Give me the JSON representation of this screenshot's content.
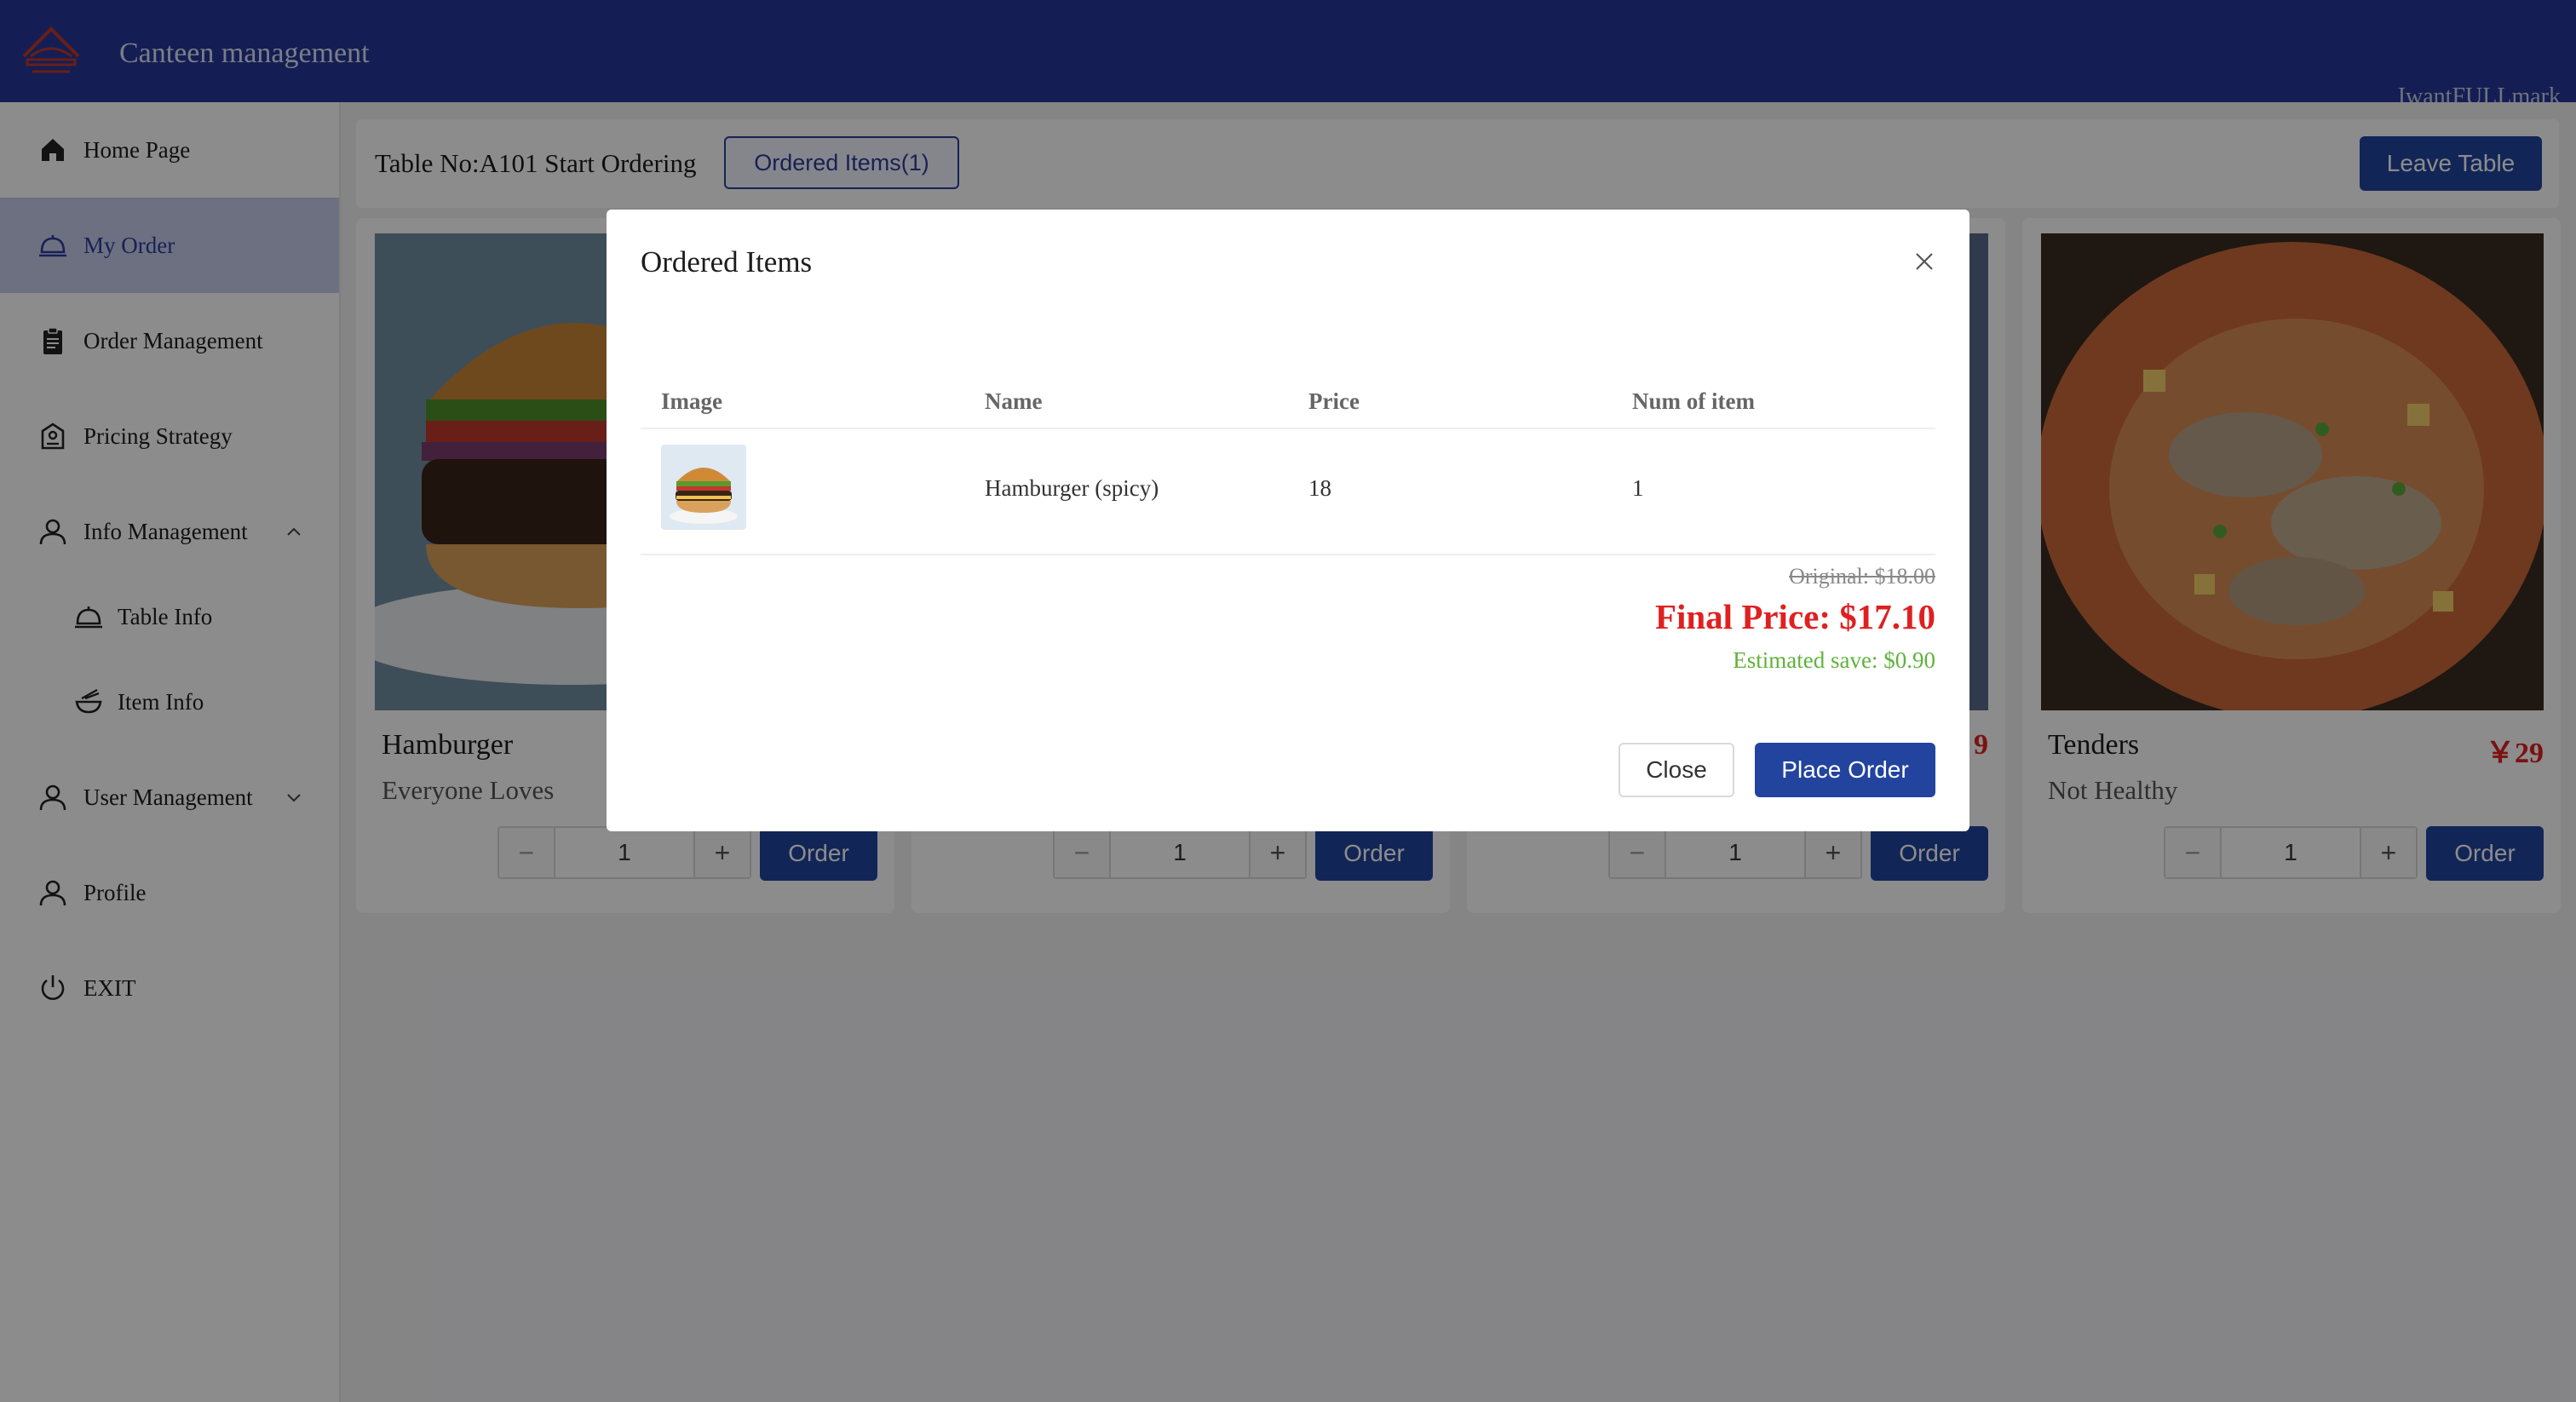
{
  "header": {
    "title": "Canteen management",
    "watermark": "IwantFULLmark"
  },
  "sidebar": {
    "items": [
      {
        "label": "Home Page",
        "icon": "home-icon"
      },
      {
        "label": "My Order",
        "icon": "dish-cover-icon",
        "active": true
      },
      {
        "label": "Order Management",
        "icon": "clipboard-icon"
      },
      {
        "label": "Pricing Strategy",
        "icon": "pricing-icon"
      },
      {
        "label": "Info Management",
        "icon": "user-icon",
        "expanded": true
      },
      {
        "label": "Table Info",
        "icon": "dish-cover-icon"
      },
      {
        "label": "Item Info",
        "icon": "bowl-icon"
      },
      {
        "label": "User Management",
        "icon": "user-icon",
        "expanded": false
      },
      {
        "label": "Profile",
        "icon": "user-icon"
      },
      {
        "label": "EXIT",
        "icon": "power-icon"
      }
    ]
  },
  "toolbar": {
    "table_label": "Table No:A101 Start Ordering",
    "ordered_items_button": "Ordered Items(1)",
    "leave_button": "Leave Table"
  },
  "cards": [
    {
      "name": "Hamburger",
      "desc": "Everyone Loves",
      "price": "",
      "qty": "1",
      "order_label": "Order"
    },
    {
      "name": "",
      "desc": "",
      "price": "",
      "qty": "1",
      "order_label": "Order"
    },
    {
      "name": "",
      "desc": "",
      "price": "9",
      "qty": "1",
      "order_label": "Order"
    },
    {
      "name": "Tenders",
      "desc": "Not Healthy",
      "price": "￥29",
      "qty": "1",
      "order_label": "Order"
    }
  ],
  "modal": {
    "title": "Ordered Items",
    "columns": [
      "Image",
      "Name",
      "Price",
      "Num of item"
    ],
    "rows": [
      {
        "name": "Hamburger (spicy)",
        "price": "18",
        "num": "1"
      }
    ],
    "original": "Original: $18.00",
    "final_price": "Final Price: $17.10",
    "saving": "Estimated save: $0.90",
    "close_button": "Close",
    "place_order_button": "Place Order"
  },
  "colors": {
    "header_bg": "#26389a",
    "primary": "#22449f",
    "price_red": "#e02020",
    "save_green": "#5fb33a",
    "active_nav_bg": "#c7ccec"
  }
}
